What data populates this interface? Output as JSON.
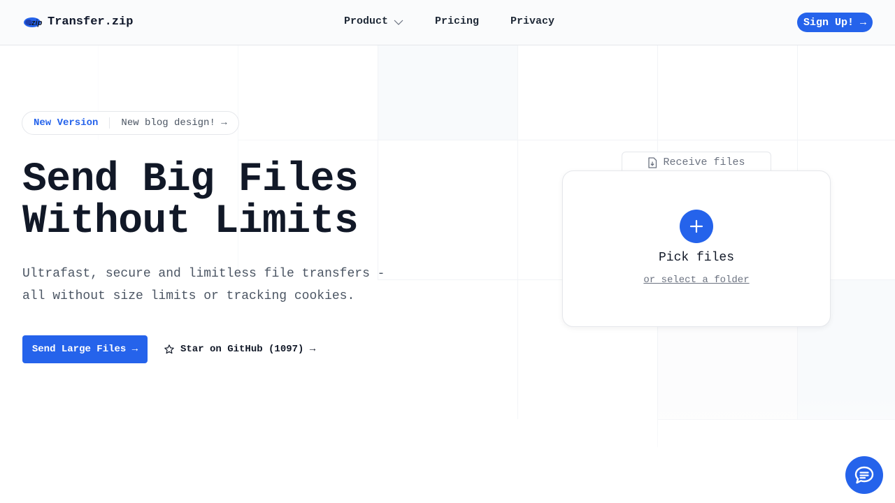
{
  "brand": {
    "name": "Transfer.zip",
    "logo_text": ".zip",
    "accent_color": "#2563eb"
  },
  "nav": {
    "items": [
      {
        "label": "Product",
        "icon": "chevron-down-icon"
      },
      {
        "label": "Pricing"
      },
      {
        "label": "Privacy"
      }
    ],
    "signup_label": "Sign Up! →"
  },
  "announcement": {
    "tag": "New Version",
    "text": "New blog design! →"
  },
  "hero": {
    "title_line1": "Send Big Files",
    "title_line2": "Without Limits",
    "subtitle": "Ultrafast, secure and limitless file transfers - all without size limits or tracking cookies.",
    "primary_cta": "Send Large Files →",
    "github_cta": "Star on GitHub (1097) →"
  },
  "uploader": {
    "receive_tab": "Receive files",
    "pick_label": "Pick files",
    "folder_label": "or select a folder"
  },
  "icons": {
    "github_star": "star-icon",
    "receive": "file-download-icon",
    "add": "plus-icon",
    "chat": "chat-bubble-icon"
  }
}
